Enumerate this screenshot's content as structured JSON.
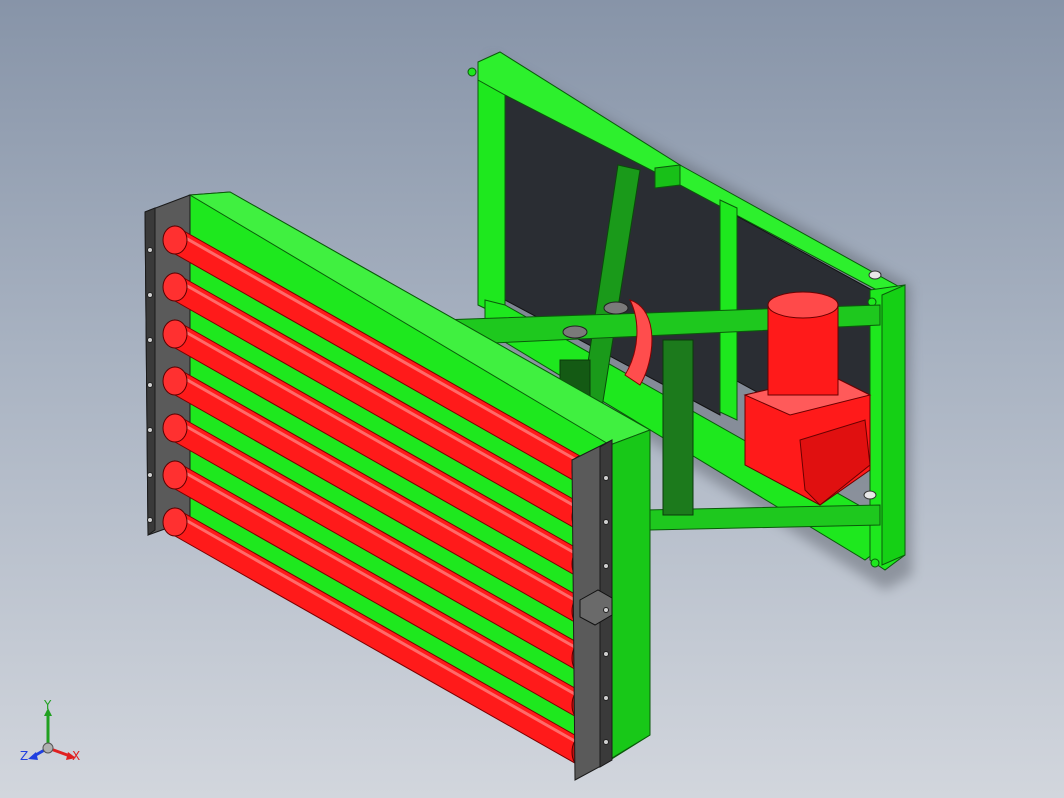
{
  "viewport": {
    "background_top": "#8794a8",
    "background_bottom": "#d2d6dd"
  },
  "model": {
    "frame_color": "#1ee81e",
    "roller_color": "#ff1a1a",
    "panel_color": "#2a2d33",
    "bracket_color": "#5a5a5a",
    "shaft_color": "#1c7a1c",
    "roller_count": 7
  },
  "triad": {
    "x_label": "X",
    "y_label": "Y",
    "z_label": "Z",
    "x_color": "#e02020",
    "y_color": "#20a020",
    "z_color": "#2040e0"
  }
}
